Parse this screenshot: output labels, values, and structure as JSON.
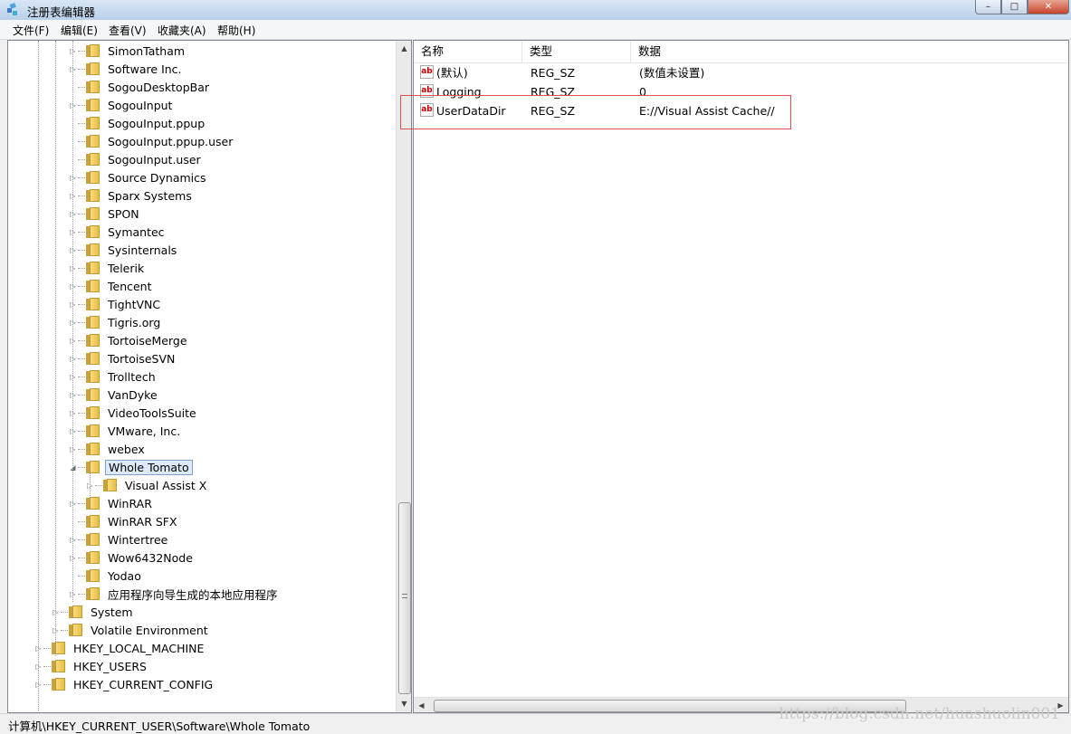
{
  "window": {
    "title": "注册表编辑器",
    "buttons": {
      "minimize": "–",
      "restore": "□",
      "close": "✕"
    }
  },
  "menu": [
    "文件(F)",
    "编辑(E)",
    "查看(V)",
    "收藏夹(A)",
    "帮助(H)"
  ],
  "tree": {
    "items": [
      {
        "label": "SimonTatham",
        "level": 3,
        "expander": "collapsed"
      },
      {
        "label": "Software Inc.",
        "level": 3,
        "expander": "collapsed"
      },
      {
        "label": "SogouDesktopBar",
        "level": 3,
        "expander": "none"
      },
      {
        "label": "SogouInput",
        "level": 3,
        "expander": "collapsed"
      },
      {
        "label": "SogouInput.ppup",
        "level": 3,
        "expander": "none"
      },
      {
        "label": "SogouInput.ppup.user",
        "level": 3,
        "expander": "none"
      },
      {
        "label": "SogouInput.user",
        "level": 3,
        "expander": "none"
      },
      {
        "label": "Source Dynamics",
        "level": 3,
        "expander": "collapsed"
      },
      {
        "label": "Sparx Systems",
        "level": 3,
        "expander": "collapsed"
      },
      {
        "label": "SPON",
        "level": 3,
        "expander": "collapsed"
      },
      {
        "label": "Symantec",
        "level": 3,
        "expander": "collapsed"
      },
      {
        "label": "Sysinternals",
        "level": 3,
        "expander": "collapsed"
      },
      {
        "label": "Telerik",
        "level": 3,
        "expander": "collapsed"
      },
      {
        "label": "Tencent",
        "level": 3,
        "expander": "collapsed"
      },
      {
        "label": "TightVNC",
        "level": 3,
        "expander": "collapsed"
      },
      {
        "label": "Tigris.org",
        "level": 3,
        "expander": "collapsed"
      },
      {
        "label": "TortoiseMerge",
        "level": 3,
        "expander": "collapsed"
      },
      {
        "label": "TortoiseSVN",
        "level": 3,
        "expander": "collapsed"
      },
      {
        "label": "Trolltech",
        "level": 3,
        "expander": "collapsed"
      },
      {
        "label": "VanDyke",
        "level": 3,
        "expander": "collapsed"
      },
      {
        "label": "VideoToolsSuite",
        "level": 3,
        "expander": "collapsed"
      },
      {
        "label": "VMware, Inc.",
        "level": 3,
        "expander": "collapsed"
      },
      {
        "label": "webex",
        "level": 3,
        "expander": "collapsed"
      },
      {
        "label": "Whole Tomato",
        "level": 3,
        "expander": "expanded",
        "selected": true
      },
      {
        "label": "Visual Assist X",
        "level": 4,
        "expander": "collapsed"
      },
      {
        "label": "WinRAR",
        "level": 3,
        "expander": "collapsed"
      },
      {
        "label": "WinRAR SFX",
        "level": 3,
        "expander": "none"
      },
      {
        "label": "Wintertree",
        "level": 3,
        "expander": "collapsed"
      },
      {
        "label": "Wow6432Node",
        "level": 3,
        "expander": "collapsed"
      },
      {
        "label": "Yodao",
        "level": 3,
        "expander": "none"
      },
      {
        "label": "应用程序向导生成的本地应用程序",
        "level": 3,
        "expander": "collapsed"
      },
      {
        "label": "System",
        "level": 2,
        "expander": "collapsed"
      },
      {
        "label": "Volatile Environment",
        "level": 2,
        "expander": "collapsed"
      },
      {
        "label": "HKEY_LOCAL_MACHINE",
        "level": 1,
        "expander": "collapsed"
      },
      {
        "label": "HKEY_USERS",
        "level": 1,
        "expander": "collapsed"
      },
      {
        "label": "HKEY_CURRENT_CONFIG",
        "level": 1,
        "expander": "collapsed"
      }
    ]
  },
  "list": {
    "columns": [
      "名称",
      "类型",
      "数据"
    ],
    "rows": [
      {
        "name": "(默认)",
        "type": "REG_SZ",
        "data": "(数值未设置)",
        "icon": "string-value-icon"
      },
      {
        "name": "Logging",
        "type": "REG_SZ",
        "data": "0",
        "icon": "string-value-icon"
      },
      {
        "name": "UserDataDir",
        "type": "REG_SZ",
        "data": "E://Visual Assist Cache//",
        "icon": "string-value-icon"
      }
    ]
  },
  "status": {
    "path": "计算机\\HKEY_CURRENT_USER\\Software\\Whole Tomato"
  },
  "watermark": "https://blog.csdn.net/huashuolin001",
  "colors": {
    "highlight_box": "#e05050",
    "selection": "#dceaf8",
    "folder": "#e9bf42"
  }
}
